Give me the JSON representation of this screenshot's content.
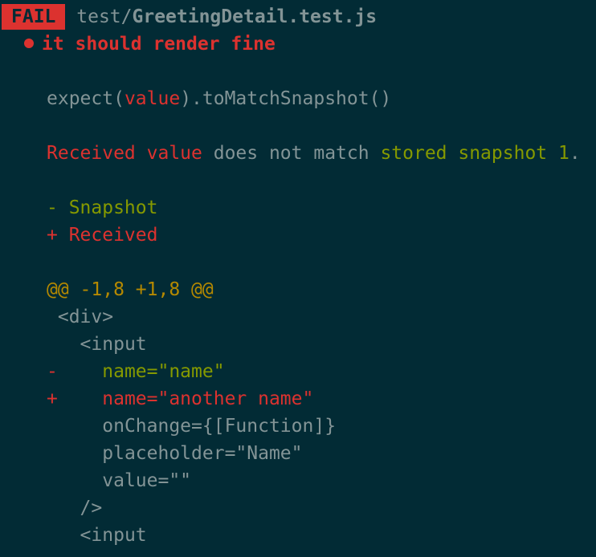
{
  "header": {
    "badge": "FAIL",
    "path_prefix": "test/",
    "path_file": "GreetingDetail.test.js"
  },
  "test": {
    "title": "it should render fine"
  },
  "expect_line": {
    "p1": "expect(",
    "p2": "value",
    "p3": ").toMatchSnapshot()"
  },
  "message": {
    "p1": "Received value",
    "p2": " does not match ",
    "p3": "stored snapshot 1",
    "p4": "."
  },
  "legend": {
    "minus": "- Snapshot",
    "plus": "+ Received"
  },
  "diff": {
    "hunk": "@@ -1,8 +1,8 @@",
    "lines": [
      {
        "marker": " ",
        "text": "<div>"
      },
      {
        "marker": " ",
        "text": "  <input"
      },
      {
        "marker": "-",
        "text": "    name=\"name\""
      },
      {
        "marker": "+",
        "text": "    name=\"another name\""
      },
      {
        "marker": " ",
        "text": "    onChange={[Function]}"
      },
      {
        "marker": " ",
        "text": "    placeholder=\"Name\""
      },
      {
        "marker": " ",
        "text": "    value=\"\""
      },
      {
        "marker": " ",
        "text": "  />"
      },
      {
        "marker": " ",
        "text": "  <input"
      }
    ]
  },
  "colors": {
    "background": "#022b35",
    "red": "#dc322f",
    "green": "#859900",
    "yellow": "#b58900",
    "gray": "#839496"
  }
}
